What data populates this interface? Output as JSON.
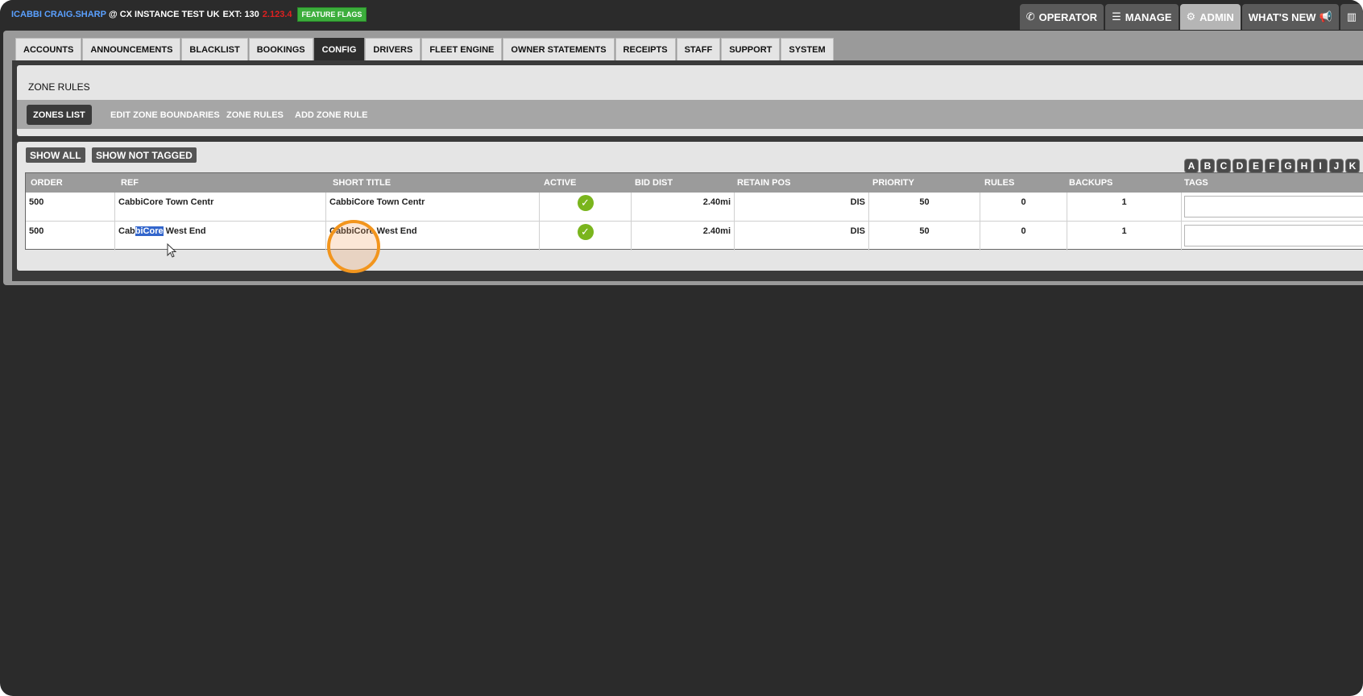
{
  "topbar": {
    "user": "ICABBI CRAIG.SHARP",
    "at": "@",
    "instance": "CX INSTANCE TEST UK",
    "ext": "EXT: 130",
    "version": "2.123.4",
    "feature_flags": "FEATURE FLAGS",
    "nav": [
      {
        "label": "OPERATOR",
        "icon": "phone-icon",
        "glyph": "✆"
      },
      {
        "label": "MANAGE",
        "icon": "list-icon",
        "glyph": "☰"
      },
      {
        "label": "ADMIN",
        "icon": "gear-icon",
        "glyph": "⚙"
      },
      {
        "label": "WHAT'S NEW",
        "icon": "megaphone-icon",
        "glyph": "📢"
      },
      {
        "label": "",
        "icon": "bar-chart-icon",
        "glyph": "▥"
      }
    ],
    "active_nav": "ADMIN"
  },
  "tabs": [
    "ACCOUNTS",
    "ANNOUNCEMENTS",
    "BLACKLIST",
    "BOOKINGS",
    "CONFIG",
    "DRIVERS",
    "FLEET ENGINE",
    "OWNER STATEMENTS",
    "RECEIPTS",
    "STAFF",
    "SUPPORT",
    "SYSTEM"
  ],
  "active_tab": "CONFIG",
  "zone": {
    "title": "ZONE RULES",
    "nav": [
      "ZONES LIST",
      "EDIT ZONE BOUNDARIES",
      "ZONE RULES",
      "ADD ZONE RULE"
    ],
    "active": "ZONES LIST"
  },
  "list": {
    "show_all": "SHOW ALL",
    "show_not_tagged": "SHOW NOT TAGGED",
    "letters": [
      "A",
      "B",
      "C",
      "D",
      "E",
      "F",
      "G",
      "H",
      "I",
      "J",
      "K"
    ],
    "columns": [
      "ORDER",
      "REF",
      "SHORT TITLE",
      "ACTIVE",
      "BID DIST",
      "RETAIN POS",
      "PRIORITY",
      "RULES",
      "BACKUPS",
      "TAGS"
    ],
    "rows": [
      {
        "order": "500",
        "ref": "CabbiCore Town Centr",
        "short_title": "CabbiCore Town Centr",
        "active": true,
        "bid_dist": "2.40mi",
        "retain_pos": "DIS",
        "priority": "50",
        "rules": "0",
        "backups": "1"
      },
      {
        "order": "500",
        "ref_pre": "Cab",
        "ref_sel": "biCore",
        "ref_post": " West End",
        "short_title": "CabbiCore West End",
        "active": true,
        "bid_dist": "2.40mi",
        "retain_pos": "DIS",
        "priority": "50",
        "rules": "0",
        "backups": "1"
      }
    ]
  }
}
